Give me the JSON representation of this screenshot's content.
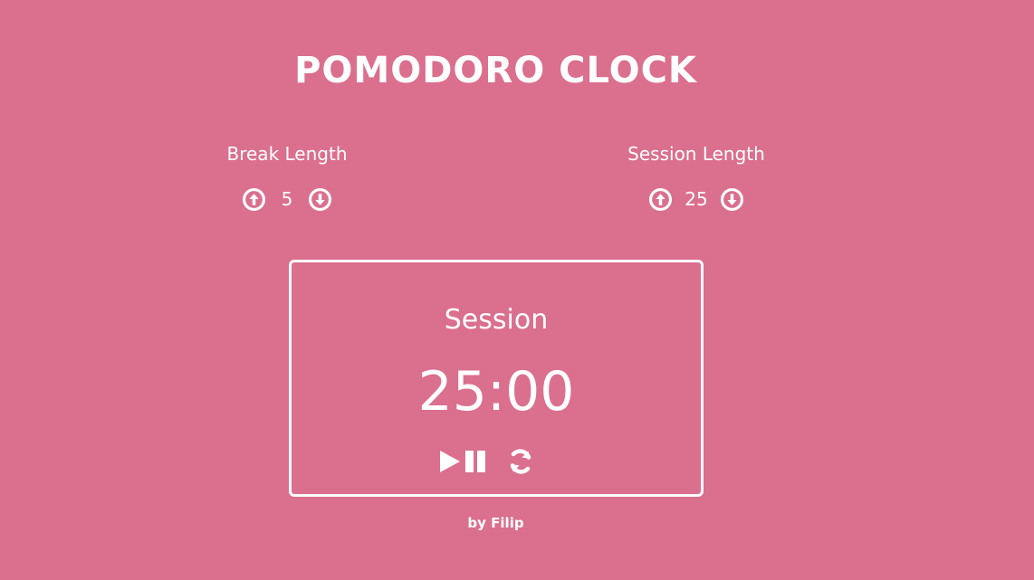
{
  "page": {
    "title": "POMODORO CLOCK",
    "background_color": "#db6f8e",
    "text_color": "#ffffff"
  },
  "break": {
    "label": "Break Length",
    "value": "5",
    "increment_icon": "arrow-up-circle-icon",
    "decrement_icon": "arrow-down-circle-icon"
  },
  "session": {
    "label": "Session Length",
    "value": "25",
    "increment_icon": "arrow-up-circle-icon",
    "decrement_icon": "arrow-down-circle-icon"
  },
  "timer": {
    "label": "Session",
    "value": "25:00",
    "controls": [
      "play-pause-icon",
      "refresh-icon"
    ]
  },
  "footer": {
    "text": "by Filip"
  }
}
